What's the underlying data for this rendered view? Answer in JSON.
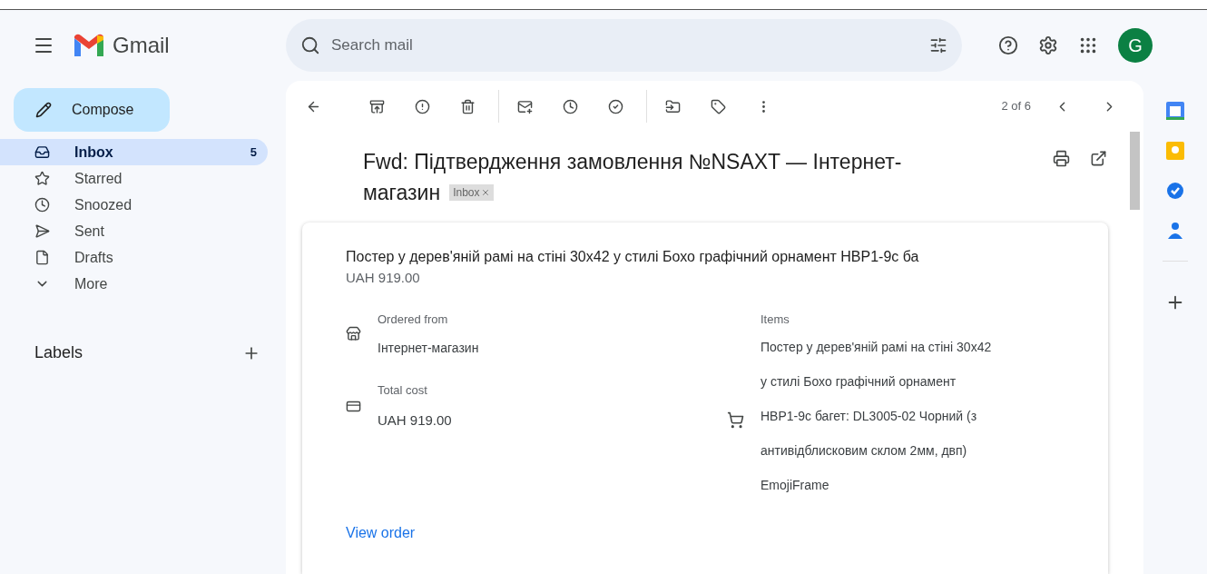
{
  "app": {
    "name": "Gmail"
  },
  "search": {
    "placeholder": "Search mail"
  },
  "account": {
    "initial": "G"
  },
  "compose": {
    "label": "Compose"
  },
  "nav": [
    {
      "kind": "inbox",
      "label": "Inbox",
      "count": "5",
      "selected": true
    },
    {
      "kind": "star",
      "label": "Starred",
      "selected": false
    },
    {
      "kind": "clock",
      "label": "Snoozed",
      "selected": false
    },
    {
      "kind": "send",
      "label": "Sent",
      "selected": false
    },
    {
      "kind": "draft",
      "label": "Drafts",
      "selected": false
    },
    {
      "kind": "more",
      "label": "More",
      "selected": false
    }
  ],
  "labels": {
    "title": "Labels"
  },
  "toolbar": {
    "position": "2 of 6"
  },
  "email": {
    "subject_lines": [
      "Fwd: Підтвердження замовлення №NSAXT — Інтернет-",
      "магазин"
    ],
    "tag": "Inbox",
    "card": {
      "title": "Постер у дерев'яній рамі на стіні 30x42 у стилі Бохо графічний орнамент HBP1-9c ба",
      "price": "UAH 919.00",
      "ordered_from_label": "Ordered from",
      "ordered_from": "Інтернет-магазин",
      "total_label": "Total cost",
      "total": "UAH 919.00",
      "items_label": "Items",
      "items": "Постер у дерев'яній рамі на стіні 30x42 у стилі Бохо графічний орнамент HBP1-9c багет: DL3005-02 Чорний (з антивідблисковим склом 2мм, двп) EmojiFrame",
      "link": "View order"
    }
  }
}
